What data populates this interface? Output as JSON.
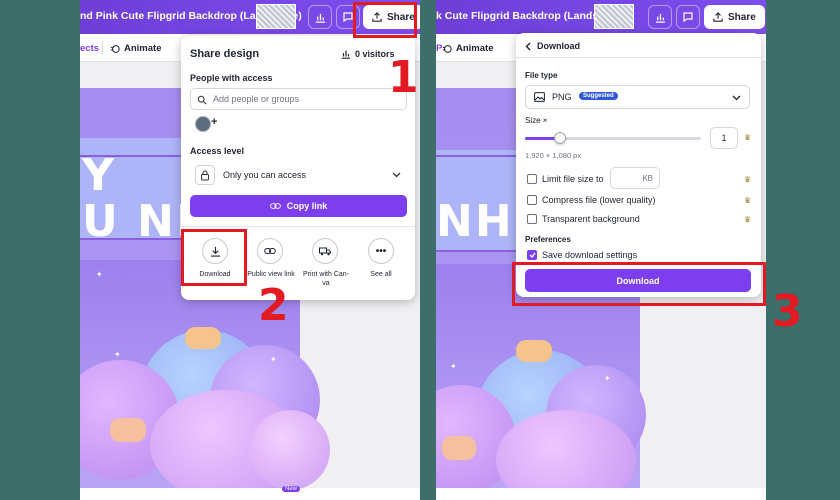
{
  "left": {
    "title": "nd Pink Cute Flipgrid Backdrop (Landscape)",
    "share_label": "Share",
    "toolbar": {
      "effects_partial": "ects",
      "animate": "Animate"
    },
    "canvas_text": {
      "line1": "Y",
      "line2": "U NHI"
    },
    "popup": {
      "title": "Share design",
      "visitors": "0 visitors",
      "people_label": "People with access",
      "people_placeholder": "Add people or groups",
      "access_label": "Access level",
      "access_value": "Only you can access",
      "copy_link": "Copy link",
      "options": [
        {
          "label": "Download"
        },
        {
          "label": "Public view link"
        },
        {
          "label": "Print with Can-\nva"
        },
        {
          "label": "See all"
        }
      ]
    },
    "new_badge": "New",
    "step1": "1",
    "step2": "2"
  },
  "right": {
    "title": "k Cute Flipgrid Backdrop (Landscape)",
    "share_label": "Share",
    "toolbar": {
      "animate": "Animate",
      "partial": "P"
    },
    "canvas_text": {
      "line1": "NHI"
    },
    "download_panel": {
      "back_label": "Download",
      "file_type_label": "File type",
      "file_type_value": "PNG",
      "suggested_badge": "Suggested",
      "size_label": "Size ×",
      "size_value": "1",
      "size_slider_fraction": 0.2,
      "dimensions": "1,920 × 1,080 px",
      "limit_label": "Limit file size to",
      "limit_unit": "KB",
      "compress_label": "Compress file (lower quality)",
      "transparent_label": "Transparent background",
      "preferences_label": "Preferences",
      "save_settings_label": "Save download settings",
      "download_button": "Download"
    },
    "step3": "3"
  },
  "colors": {
    "accent": "#7d3ef0",
    "highlight": "#e21b23",
    "backdrop": "#3d6e6a"
  }
}
